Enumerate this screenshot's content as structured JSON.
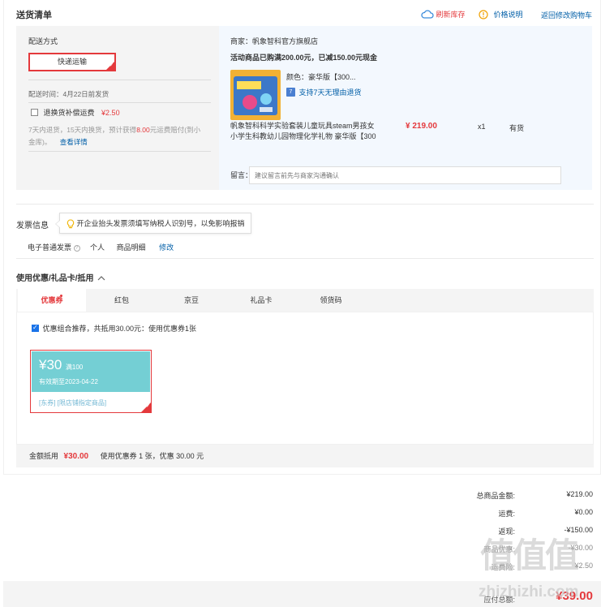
{
  "header": {
    "title": "送货清单",
    "refresh_stock": "刷新库存",
    "price_explain": "价格说明",
    "back_to_cart": "返回修改购物车"
  },
  "shipping": {
    "label": "配送方式",
    "method": "快递运输",
    "delivery_time": "配送时间：4月22日前发货",
    "insurance_label": "退换货补偿运费",
    "insurance_price": "¥2.50",
    "insurance_desc_1": "7天内退货，15天内换货，预计获得",
    "insurance_amount": "8.00",
    "insurance_desc_2": "元运费赔付(到小",
    "insurance_desc_3": "金库)。",
    "view_detail": "查看详情"
  },
  "merchant": {
    "name": "商家：帆象智科官方旗舰店",
    "promo": "活动商品已购满200.00元，已减150.00元现金",
    "color": "颜色：豪华版【300...",
    "return_policy": "支持7天无理由退货",
    "return_badge": "7",
    "product_title_1": "帆象智科科学实验套装儿童玩具steam男孩女",
    "product_title_2": "小学生科教幼儿园物理化学礼物 豪华版【300",
    "price": "¥ 219.00",
    "qty": "x1",
    "stock": "有货",
    "message_label": "留言：",
    "message_placeholder": "建议留言前先与商家沟通确认"
  },
  "invoice": {
    "title": "发票信息",
    "tip": "开企业抬头发票须填写纳税人识别号，以免影响报销",
    "type": "电子普通发票",
    "person": "个人",
    "detail": "商品明细",
    "edit": "修改"
  },
  "coupon": {
    "title": "使用优惠/礼品卡/抵用",
    "tabs": [
      "优惠券",
      "红包",
      "京豆",
      "礼品卡",
      "领货码"
    ],
    "recommend": "优惠组合推荐，共抵用30.00元：使用优惠券1张",
    "card_amount": "¥30",
    "card_condition": "满100",
    "card_expire": "有效期至2023-04-22",
    "card_tags": "[东券] [限店铺指定商品]",
    "discount_label": "金额抵用",
    "discount_amount": "¥30.00",
    "discount_desc": "使用优惠券 1 张，优惠 30.00 元"
  },
  "summary": {
    "items": [
      {
        "label": "总商品金额:",
        "value": "¥219.00"
      },
      {
        "label": "运费:",
        "value": "¥0.00"
      },
      {
        "label": "返现:",
        "value": "-¥150.00"
      },
      {
        "label": "商品优惠:",
        "value": "-¥30.00"
      },
      {
        "label": "运费险:",
        "value": "¥2.50"
      }
    ],
    "total_label": "应付总额:",
    "total_value": "¥39.00"
  },
  "colors": {
    "accent_red": "#e4393c",
    "link_blue": "#005ea7",
    "coupon_teal": "#74cfd4"
  },
  "watermark": {
    "text": "zhizhizhi.com",
    "logo": "值值值"
  }
}
